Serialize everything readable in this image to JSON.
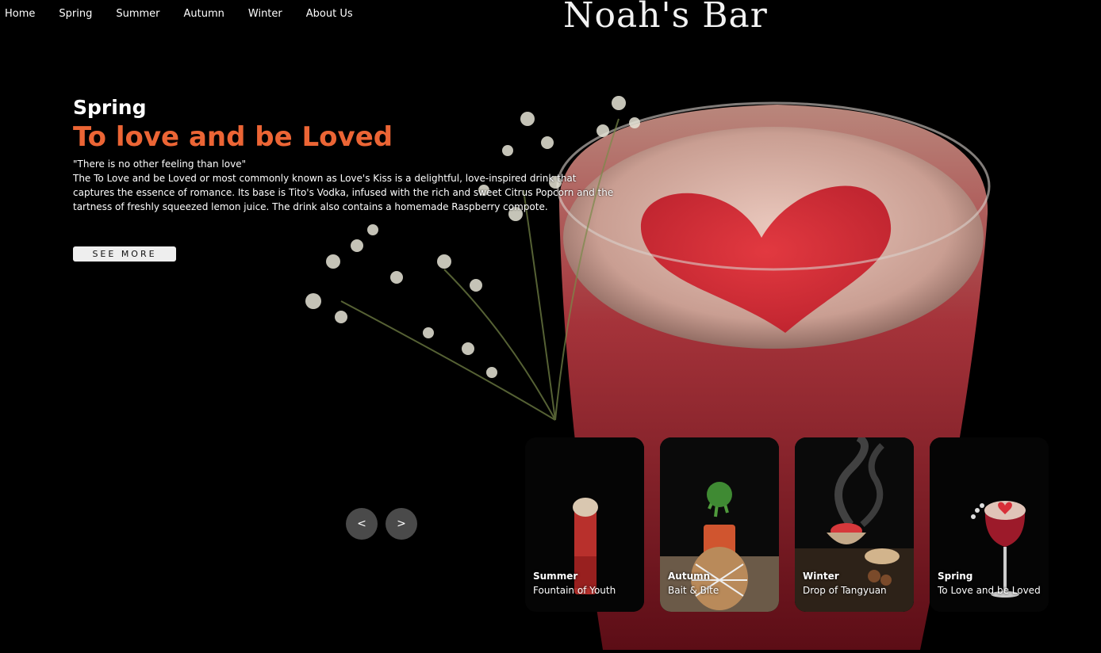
{
  "nav": {
    "items": [
      {
        "label": "Home"
      },
      {
        "label": "Spring"
      },
      {
        "label": "Summer"
      },
      {
        "label": "Autumn"
      },
      {
        "label": "Winter"
      },
      {
        "label": "About Us"
      }
    ]
  },
  "brand": {
    "title": "Noah's Bar"
  },
  "hero": {
    "season": "Spring",
    "title": "To love and be Loved",
    "quote": "\"There is no other feeling than love\"",
    "description": "The To Love and be Loved or most commonly known as Love's Kiss is a delightful, love-inspired drink that captures the essence of romance. Its base is Tito's Vodka, infused with the rich and sweet Citrus Popcorn and the tartness of freshly squeezed lemon juice. The drink also contains a homemade Raspberry compote.",
    "button_label": "SEE MORE",
    "image_icon": "heart-cocktail-image"
  },
  "carousel": {
    "prev_label": "<",
    "next_label": ">",
    "cards": [
      {
        "season": "Summer",
        "name": "Fountain of Youth",
        "icon": "tall-red-cocktail"
      },
      {
        "season": "Autumn",
        "name": "Bait & Bite",
        "icon": "rope-wrapped-cocktail"
      },
      {
        "season": "Winter",
        "name": "Drop of Tangyuan",
        "icon": "smoking-bowl"
      },
      {
        "season": "Spring",
        "name": "To Love and be Loved",
        "icon": "heart-coupe-glass"
      }
    ]
  },
  "colors": {
    "background": "#000000",
    "accent": "#ec6535",
    "text": "#ffffff",
    "arrow_bg": "#4a4a4a"
  }
}
